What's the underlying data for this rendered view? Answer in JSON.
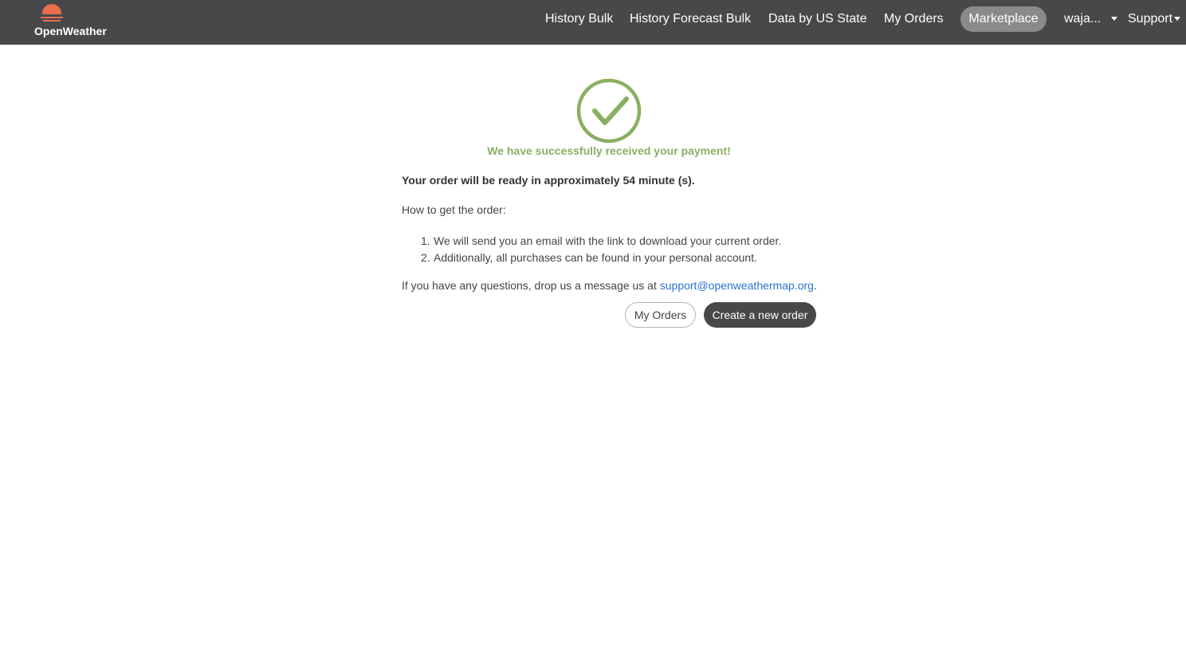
{
  "brand": {
    "name": "OpenWeather",
    "logo_icon": "sun-setting-logo-icon",
    "logo_color": "#e96e50"
  },
  "nav": {
    "history_bulk": "History Bulk",
    "history_forecast_bulk": "History Forecast Bulk",
    "data_by_us_state": "Data by US State",
    "my_orders": "My Orders",
    "marketplace": "Marketplace",
    "user": "waja...",
    "support": "Support"
  },
  "colors": {
    "header_bg": "#48484a",
    "active_pill": "#8a8a8a",
    "success_green": "#8aaf63",
    "link_blue": "#2a72d4"
  },
  "confirmation": {
    "icon": "check-circle-icon",
    "success_message": "We have successfully received your payment!",
    "order_ready": "Your order will be ready in approximately 54 minute (s).",
    "how_to": "How to get the order:",
    "steps": [
      {
        "num": "1.",
        "text": "We will send you an email with the link to download your current order."
      },
      {
        "num": "2.",
        "text": "Additionally, all purchases can be found in your personal account."
      }
    ],
    "questions_prefix": "If you have any questions, drop us a message us at ",
    "support_email": "support@openweathermap.org",
    "questions_suffix": "."
  },
  "actions": {
    "my_orders": "My Orders",
    "create_order": "Create a new order"
  }
}
